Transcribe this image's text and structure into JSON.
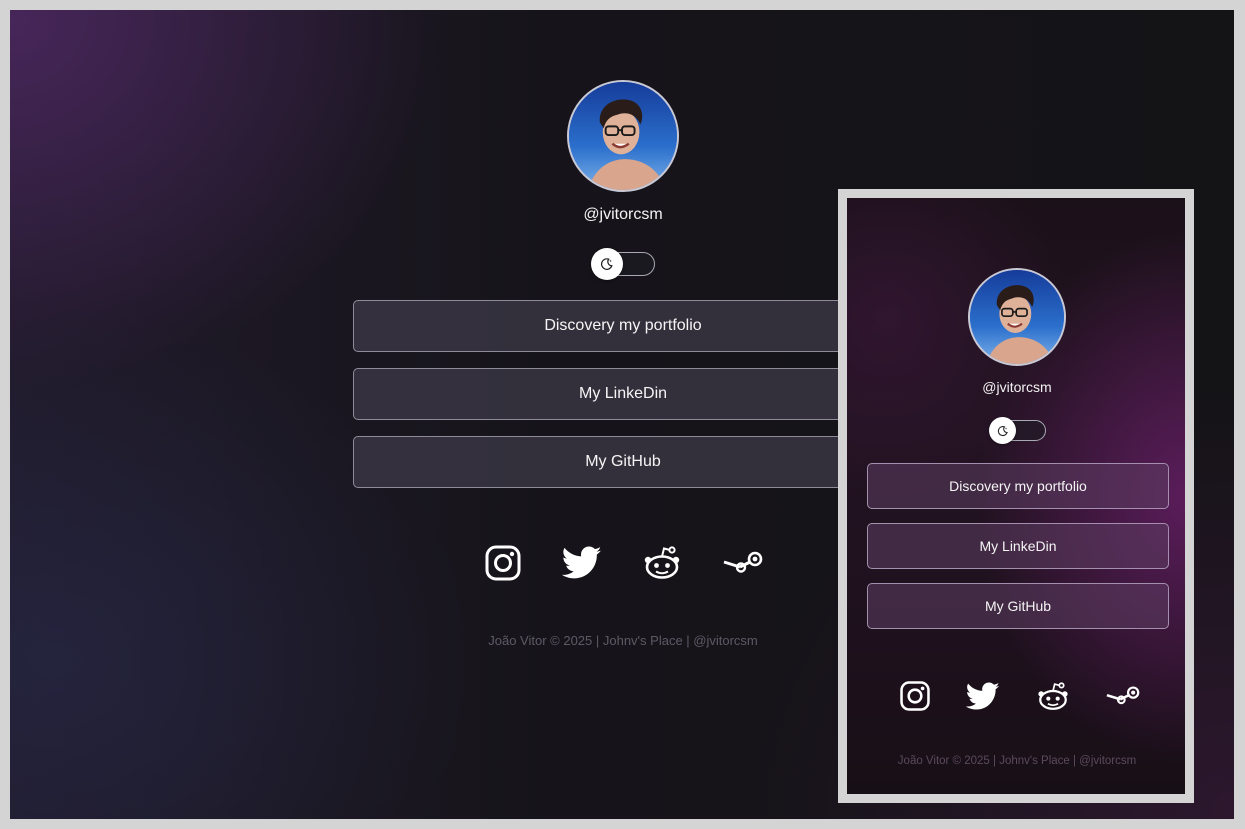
{
  "profile": {
    "handle": "@jvitorcsm",
    "avatar_alt": "profile photo"
  },
  "theme_toggle": {
    "icon": "moon-icon",
    "state": "dark"
  },
  "links": [
    {
      "label": "Discovery my portfolio"
    },
    {
      "label": "My LinkeDin"
    },
    {
      "label": "My GitHub"
    }
  ],
  "social": [
    {
      "name": "instagram",
      "icon": "instagram-icon"
    },
    {
      "name": "twitter",
      "icon": "twitter-icon"
    },
    {
      "name": "reddit",
      "icon": "reddit-icon"
    },
    {
      "name": "steam",
      "icon": "steam-icon"
    }
  ],
  "footer": {
    "text": "João Vitor © 2025 | Johnv's Place | @jvitorcsm"
  },
  "colors": {
    "background": "#16141a",
    "button_bg": "#3e3a48",
    "button_border": "#8e8a99",
    "text": "#f5f5f5",
    "footer_text": "#5d5a66",
    "mobile_accent": "#6e206e"
  }
}
